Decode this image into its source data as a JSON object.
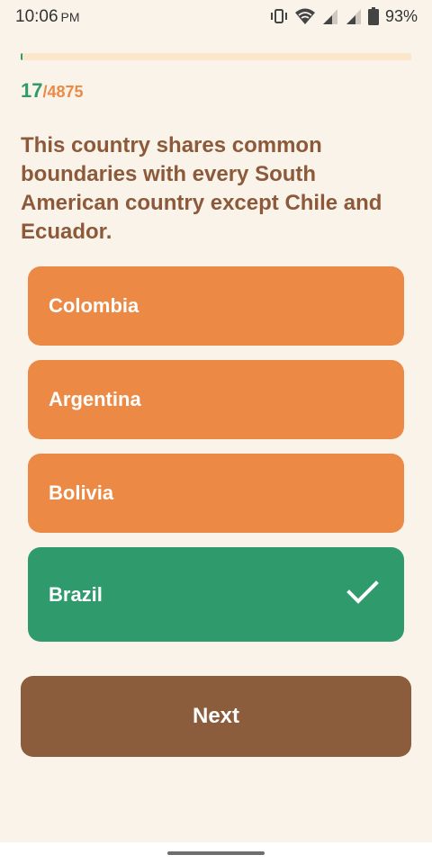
{
  "status_bar": {
    "time": "10:06",
    "ampm": "PM",
    "battery": "93%"
  },
  "progress": {
    "current": "17",
    "total": "/4875",
    "fraction": 0.0035
  },
  "question": {
    "text": "This country shares common boundaries with every South American country except Chile and Ecuador."
  },
  "options": [
    {
      "label": "Colombia",
      "state": "default"
    },
    {
      "label": "Argentina",
      "state": "default"
    },
    {
      "label": "Bolivia",
      "state": "default"
    },
    {
      "label": "Brazil",
      "state": "correct"
    }
  ],
  "next_button": {
    "label": "Next"
  },
  "colors": {
    "background": "#faf3ea",
    "accent_orange": "#ec8a45",
    "correct_green": "#2f9a6c",
    "brown": "#8c5d3c",
    "question_text": "#8c5a3a",
    "progress_track": "#fce6cc"
  },
  "icons": {
    "vibrate": "vibrate-icon",
    "wifi": "wifi-icon",
    "signal": "signal-icon",
    "battery": "battery-icon",
    "check": "check-icon"
  }
}
